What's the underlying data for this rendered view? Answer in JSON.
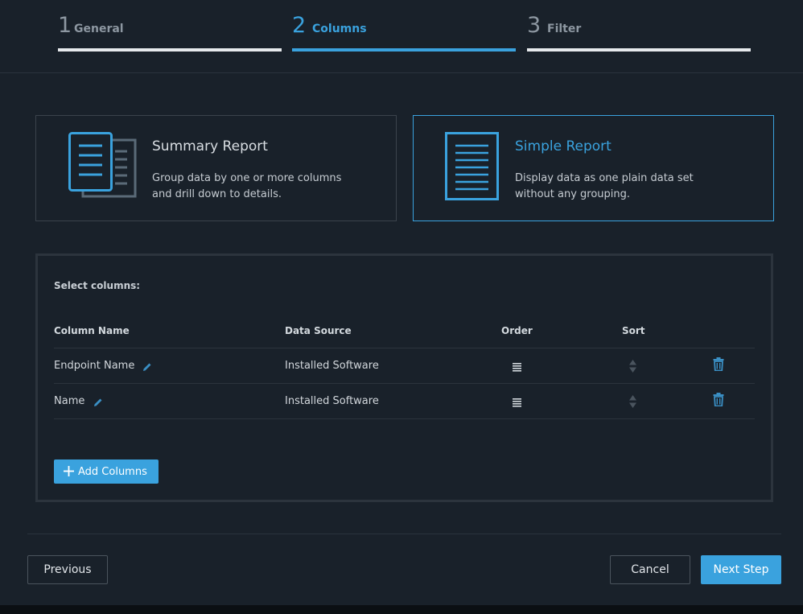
{
  "stepper": {
    "steps": [
      {
        "number": "1",
        "label": "General"
      },
      {
        "number": "2",
        "label": "Columns"
      },
      {
        "number": "3",
        "label": "Filter"
      }
    ]
  },
  "report_types": {
    "summary": {
      "title": "Summary Report",
      "desc_line1": "Group data by one or more columns",
      "desc_line2": "and drill down to details."
    },
    "simple": {
      "title": "Simple Report",
      "desc_line1": "Display data as one plain data set",
      "desc_line2": "without any grouping."
    }
  },
  "columns_panel": {
    "caption": "Select columns:",
    "headers": {
      "column_name": "Column Name",
      "data_source": "Data Source",
      "order": "Order",
      "sort": "Sort"
    },
    "rows": [
      {
        "column_name": "Endpoint Name",
        "data_source": "Installed Software"
      },
      {
        "column_name": "Name",
        "data_source": "Installed Software"
      }
    ],
    "add_button": "Add Columns"
  },
  "footer": {
    "previous": "Previous",
    "cancel": "Cancel",
    "next": "Next Step"
  },
  "colors": {
    "accent": "#3aa2de",
    "background": "#19212a",
    "border": "#3b434c"
  }
}
